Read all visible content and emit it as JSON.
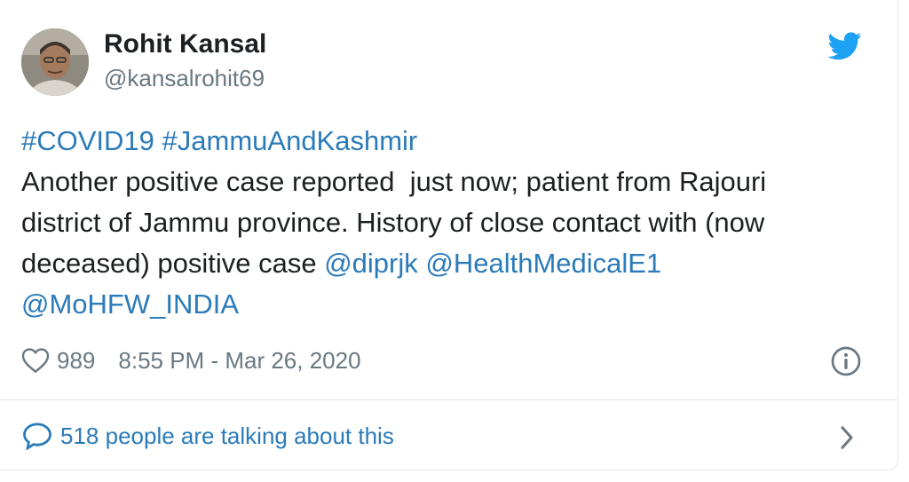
{
  "author": {
    "name": "Rohit Kansal",
    "handle": "@kansalrohit69",
    "avatar_icon": "person-photo"
  },
  "brand": {
    "icon": "twitter-bird-icon",
    "color": "#1da1f2"
  },
  "tweet": {
    "hashtag_1": "#COVID19",
    "hashtag_2": "#JammuAndKashmir",
    "line_2": "Another positive case reported  just now; patient from Rajouri",
    "line_3": "district of Jammu province. History of close contact with (now",
    "line_4_text": "deceased) positive case ",
    "mention_1": "@diprjk",
    "mention_2": "@HealthMedicalE1",
    "mention_3": "@MoHFW_INDIA"
  },
  "meta": {
    "likes": "989",
    "timestamp": "8:55 PM - Mar 26, 2020",
    "info_icon": "info-icon"
  },
  "footer": {
    "conversation_label": "518 people are talking about this",
    "chevron_icon": "chevron-right-icon"
  },
  "colors": {
    "link": "#2b7bb9",
    "text": "#1c2022",
    "muted": "#697882",
    "border": "#e1e8ed"
  }
}
